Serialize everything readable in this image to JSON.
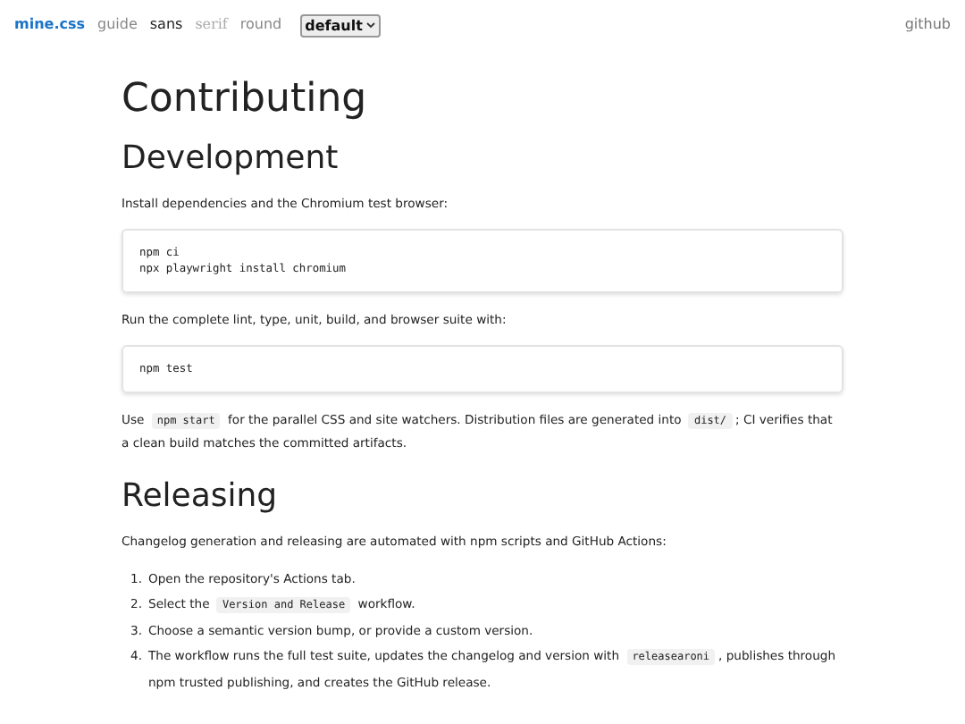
{
  "nav": {
    "brand": "mine.css",
    "links": [
      {
        "label": "guide",
        "kind": "page"
      },
      {
        "label": "sans",
        "kind": "font",
        "selected": true
      },
      {
        "label": "serif",
        "kind": "font",
        "selected": false
      },
      {
        "label": "round",
        "kind": "font",
        "selected": false
      }
    ],
    "theme_select": {
      "value": "default"
    },
    "right_link": "github"
  },
  "title": "Contributing",
  "sections": [
    {
      "heading": "Development",
      "blocks": [
        {
          "kind": "para",
          "parts": [
            {
              "text": "Install dependencies and the Chromium test browser:"
            }
          ]
        },
        {
          "kind": "code",
          "lines": [
            "npm ci",
            "npx playwright install chromium"
          ]
        },
        {
          "kind": "para",
          "parts": [
            {
              "text": "Run the complete lint, type, unit, build, and browser suite with:"
            }
          ]
        },
        {
          "kind": "code",
          "lines": [
            "npm test"
          ]
        },
        {
          "kind": "para",
          "parts": [
            {
              "text": "Use "
            },
            {
              "code": "npm start"
            },
            {
              "text": " for the parallel CSS and site watchers. Distribution files are generated into "
            },
            {
              "code": "dist/"
            },
            {
              "text": "; CI verifies that a clean build matches the committed artifacts."
            }
          ]
        }
      ]
    },
    {
      "heading": "Releasing",
      "blocks": [
        {
          "kind": "para",
          "parts": [
            {
              "text": "Changelog generation and releasing are automated with npm scripts and GitHub Actions:"
            }
          ]
        },
        {
          "kind": "list",
          "items": [
            {
              "number": "1.",
              "parts": [
                {
                  "text": "Open the repository's Actions tab."
                }
              ]
            },
            {
              "number": "2.",
              "parts": [
                {
                  "text": "Select the "
                },
                {
                  "code": "Version and Release"
                },
                {
                  "text": " workflow."
                }
              ]
            },
            {
              "number": "3.",
              "parts": [
                {
                  "text": "Choose a semantic version bump, or provide a custom version."
                }
              ]
            },
            {
              "number": "4.",
              "parts": [
                {
                  "text": "The workflow runs the full test suite, updates the changelog and version with "
                },
                {
                  "code": "releasearoni"
                },
                {
                  "text": ", publishes through npm trusted publishing, and creates the GitHub release."
                }
              ]
            }
          ]
        }
      ]
    }
  ]
}
